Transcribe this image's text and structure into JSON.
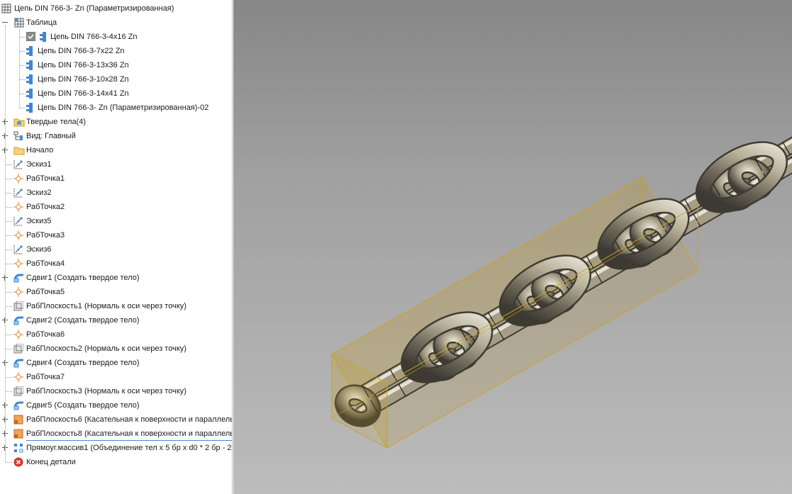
{
  "tree": {
    "root": {
      "label": "Цепь DIN 766-3-   Zn (Параметризированная)",
      "icon": "part-table-icon"
    },
    "table": {
      "label": "Таблица",
      "icon": "table-icon"
    },
    "table_rows": [
      {
        "label": "Цепь DIN 766-3-4x16 Zn",
        "icon": "table-row-icon",
        "checked": true
      },
      {
        "label": "Цепь DIN 766-3-7x22 Zn",
        "icon": "table-row-icon",
        "checked": false
      },
      {
        "label": "Цепь DIN 766-3-13x36 Zn",
        "icon": "table-row-icon",
        "checked": false
      },
      {
        "label": "Цепь DIN 766-3-10x28 Zn",
        "icon": "table-row-icon",
        "checked": false
      },
      {
        "label": "Цепь DIN 766-3-14x41 Zn",
        "icon": "table-row-icon",
        "checked": false
      },
      {
        "label": "Цепь DIN 766-3-   Zn (Параметризированная)-02",
        "icon": "table-row-icon",
        "checked": false
      }
    ],
    "features": [
      {
        "label": "Твердые тела(4)",
        "icon": "solid-bodies-icon",
        "expandable": true
      },
      {
        "label": "Вид: Главный",
        "icon": "view-icon",
        "expandable": true
      },
      {
        "label": "Начало",
        "icon": "origin-folder-icon",
        "expandable": true
      },
      {
        "label": "Эскиз1",
        "icon": "sketch-icon",
        "expandable": false
      },
      {
        "label": "РабТочка1",
        "icon": "work-point-icon",
        "expandable": false
      },
      {
        "label": "Эскиз2",
        "icon": "sketch-icon",
        "expandable": false
      },
      {
        "label": "РабТочка2",
        "icon": "work-point-icon",
        "expandable": false
      },
      {
        "label": "Эскиз5",
        "icon": "sketch-icon",
        "expandable": false
      },
      {
        "label": "РабТочка3",
        "icon": "work-point-icon",
        "expandable": false
      },
      {
        "label": "Эскиз6",
        "icon": "sketch-icon",
        "expandable": false
      },
      {
        "label": "РабТочка4",
        "icon": "work-point-icon",
        "expandable": false
      },
      {
        "label": "Сдвиг1 (Создать твердое тело)",
        "icon": "sweep-icon",
        "expandable": true
      },
      {
        "label": "РабТочка5",
        "icon": "work-point-icon",
        "expandable": false
      },
      {
        "label": "РабПлоскость1 (Нормаль к оси через точку)",
        "icon": "work-plane-icon",
        "expandable": false
      },
      {
        "label": "Сдвиг2 (Создать твердое тело)",
        "icon": "sweep-icon",
        "expandable": true
      },
      {
        "label": "РабТочка6",
        "icon": "work-point-icon",
        "expandable": false
      },
      {
        "label": "РабПлоскость2 (Нормаль к оси через точку)",
        "icon": "work-plane-icon",
        "expandable": false
      },
      {
        "label": "Сдвиг4 (Создать твердое тело)",
        "icon": "sweep-icon",
        "expandable": true
      },
      {
        "label": "РабТочка7",
        "icon": "work-point-icon",
        "expandable": false
      },
      {
        "label": "РабПлоскость3 (Нормаль к оси через точку)",
        "icon": "work-plane-icon",
        "expandable": false
      },
      {
        "label": "Сдвиг5 (Создать твердое тело)",
        "icon": "sweep-icon",
        "expandable": true
      },
      {
        "label": "РабПлоскость6 (Касательная к поверхности и параллель",
        "icon": "work-plane-tangent-icon",
        "expandable": true
      },
      {
        "label": "РабПлоскость8 (Касательная к поверхности и параллель",
        "icon": "work-plane-tangent-icon",
        "expandable": true,
        "selected": true
      },
      {
        "label": "Прямоуг.массив1 (Объединение тел x 5 бр x d0 * 2 бр - 2",
        "icon": "rectangular-pattern-icon",
        "expandable": true
      },
      {
        "label": "Конец детали",
        "icon": "end-of-part-icon",
        "expandable": false
      }
    ]
  },
  "colors": {
    "selection": "#4a8ad0",
    "bounding_box": "#c9a227",
    "chain_metal": "#b7b09a"
  }
}
